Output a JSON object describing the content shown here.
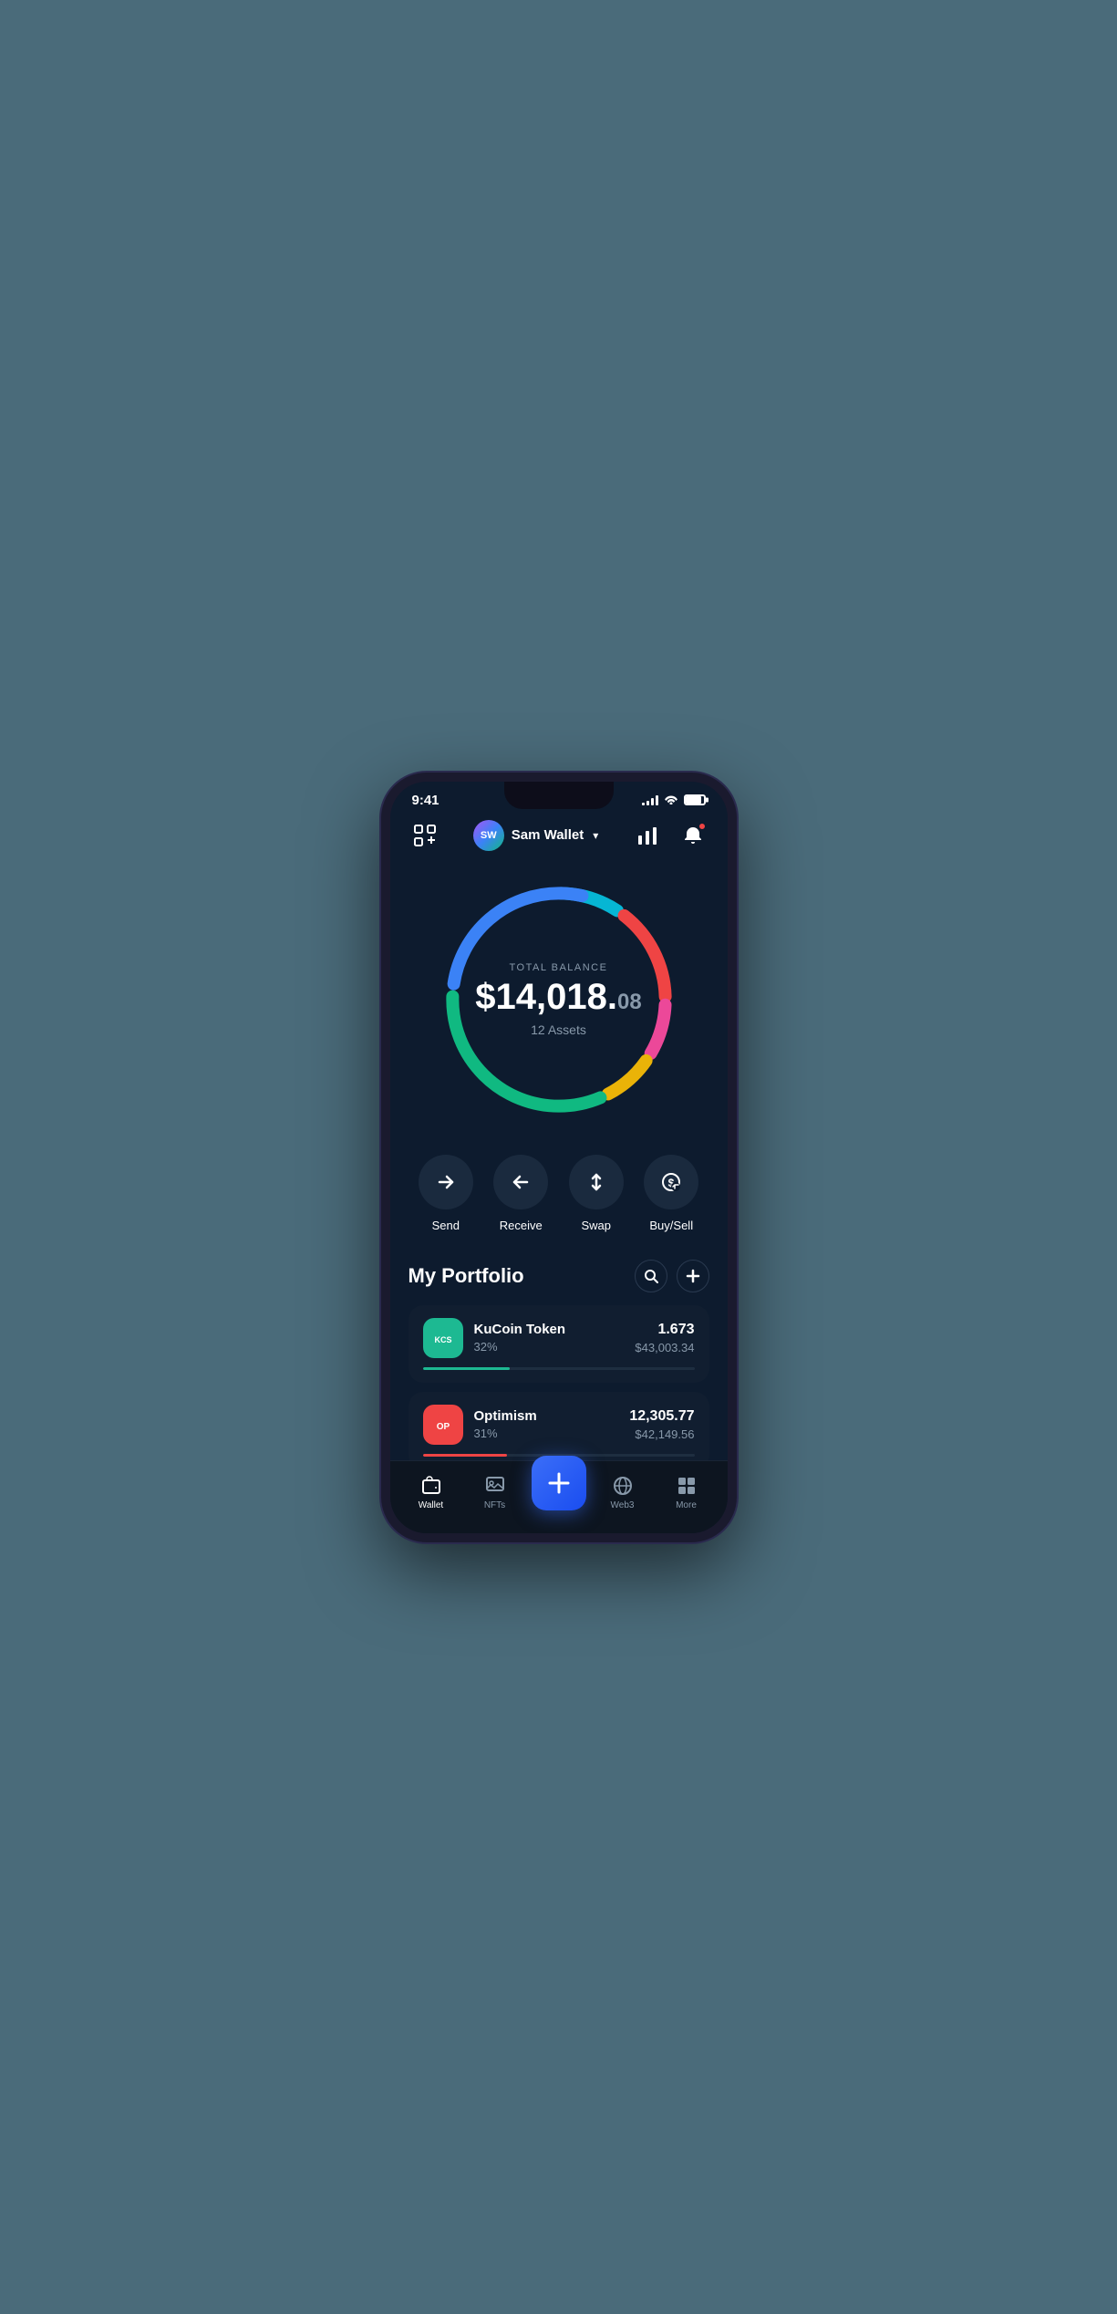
{
  "statusBar": {
    "time": "9:41",
    "signalBars": [
      3,
      5,
      8,
      11
    ],
    "batteryLevel": 85
  },
  "header": {
    "scanLabel": "scan",
    "userName": "Sam Wallet",
    "chevron": "▾",
    "avatarText": "SW"
  },
  "balance": {
    "label": "TOTAL BALANCE",
    "whole": "$14,018.",
    "cents": "08",
    "assets": "12 Assets"
  },
  "actions": [
    {
      "id": "send",
      "label": "Send",
      "icon": "→"
    },
    {
      "id": "receive",
      "label": "Receive",
      "icon": "←"
    },
    {
      "id": "swap",
      "label": "Swap",
      "icon": "⇅"
    },
    {
      "id": "buysell",
      "label": "Buy/Sell",
      "icon": "$"
    }
  ],
  "portfolio": {
    "title": "My Portfolio",
    "assets": [
      {
        "id": "kucoin",
        "name": "KuCoin Token",
        "percent": "32%",
        "amount": "1.673",
        "usd": "$43,003.34",
        "progressWidth": "32",
        "progressColor": "#1db992",
        "logoText": "KCS",
        "logoClass": "kucoin-logo"
      },
      {
        "id": "optimism",
        "name": "Optimism",
        "percent": "31%",
        "amount": "12,305.77",
        "usd": "$42,149.56",
        "progressWidth": "31",
        "progressColor": "#ef4444",
        "logoText": "OP",
        "logoClass": "optimism-logo"
      }
    ]
  },
  "tabBar": {
    "tabs": [
      {
        "id": "wallet",
        "label": "Wallet",
        "active": true
      },
      {
        "id": "nfts",
        "label": "NFTs",
        "active": false
      },
      {
        "id": "center",
        "label": "",
        "active": false
      },
      {
        "id": "web3",
        "label": "Web3",
        "active": false
      },
      {
        "id": "more",
        "label": "More",
        "active": false
      }
    ]
  },
  "donut": {
    "segments": [
      {
        "color": "#ef4444",
        "offset": 0,
        "dash": 45
      },
      {
        "color": "#ec4899",
        "offset": 45,
        "dash": 25
      },
      {
        "color": "#eab308",
        "offset": 70,
        "dash": 25
      },
      {
        "color": "#10b981",
        "offset": 95,
        "dash": 100
      },
      {
        "color": "#3b82f6",
        "offset": 195,
        "dash": 85
      },
      {
        "color": "#06b6d4",
        "offset": 280,
        "dash": 12
      }
    ],
    "circumference": 314,
    "radius": 50,
    "gap": 4
  }
}
